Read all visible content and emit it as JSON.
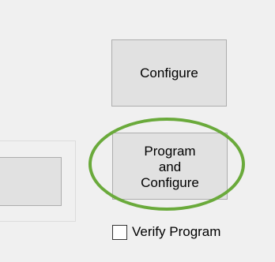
{
  "buttons": {
    "configure_label": "Configure",
    "program_configure_label": "Program\nand\nConfigure"
  },
  "verify": {
    "label": "Verify Program",
    "checked": false
  },
  "colors": {
    "background": "#f0f0f0",
    "button_face": "#e1e1e1",
    "button_border": "#adadad",
    "highlight_ring": "#6aaa3b"
  }
}
